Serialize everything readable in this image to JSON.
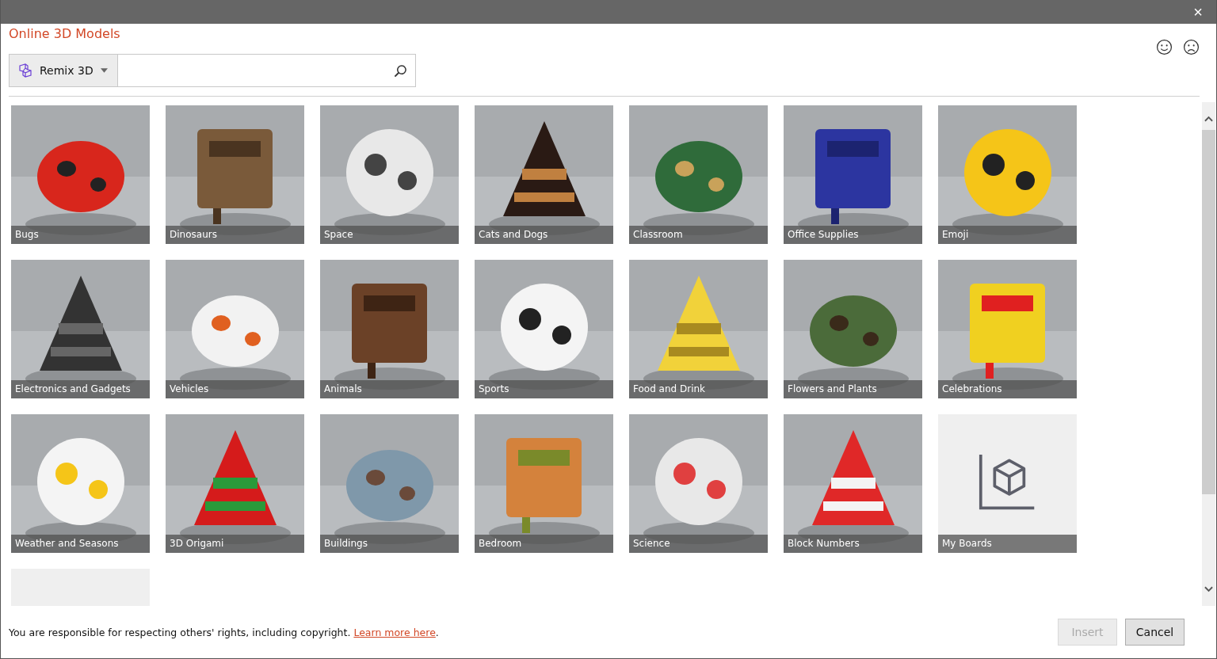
{
  "window": {
    "title_bar": {
      "close": "×"
    }
  },
  "heading": "Online 3D Models",
  "search": {
    "source": "Remix 3D"
  },
  "tiles": [
    {
      "kind": "picture",
      "label": "Bugs"
    },
    {
      "kind": "picture",
      "label": "Dinosaurs"
    },
    {
      "kind": "picture",
      "label": "Space"
    },
    {
      "kind": "picture",
      "label": "Cats and Dogs"
    },
    {
      "kind": "picture",
      "label": "Classroom"
    },
    {
      "kind": "picture",
      "label": "Office Supplies"
    },
    {
      "kind": "picture",
      "label": "Emoji"
    },
    {
      "kind": "picture",
      "label": "Electronics and Gadgets"
    },
    {
      "kind": "picture",
      "label": "Vehicles"
    },
    {
      "kind": "picture",
      "label": "Animals"
    },
    {
      "kind": "picture",
      "label": "Sports"
    },
    {
      "kind": "picture",
      "label": "Food and Drink"
    },
    {
      "kind": "picture",
      "label": "Flowers and Plants"
    },
    {
      "kind": "picture",
      "label": "Celebrations"
    },
    {
      "kind": "picture",
      "label": "Weather and Seasons"
    },
    {
      "kind": "picture",
      "label": "3D Origami"
    },
    {
      "kind": "picture",
      "label": "Buildings"
    },
    {
      "kind": "picture",
      "label": "Bedroom"
    },
    {
      "kind": "picture",
      "label": "Science"
    },
    {
      "kind": "picture",
      "label": "Block Numbers"
    },
    {
      "kind": "boards",
      "label": "My Boards"
    },
    {
      "kind": "blank"
    }
  ],
  "footer": {
    "notice": "You are responsible for respecting others' rights, including copyright. ",
    "link": "Learn more here",
    "end": "."
  },
  "buttons": [
    {
      "label": "Insert",
      "disabled": true
    },
    {
      "label": "Cancel",
      "disabled": false
    }
  ]
}
